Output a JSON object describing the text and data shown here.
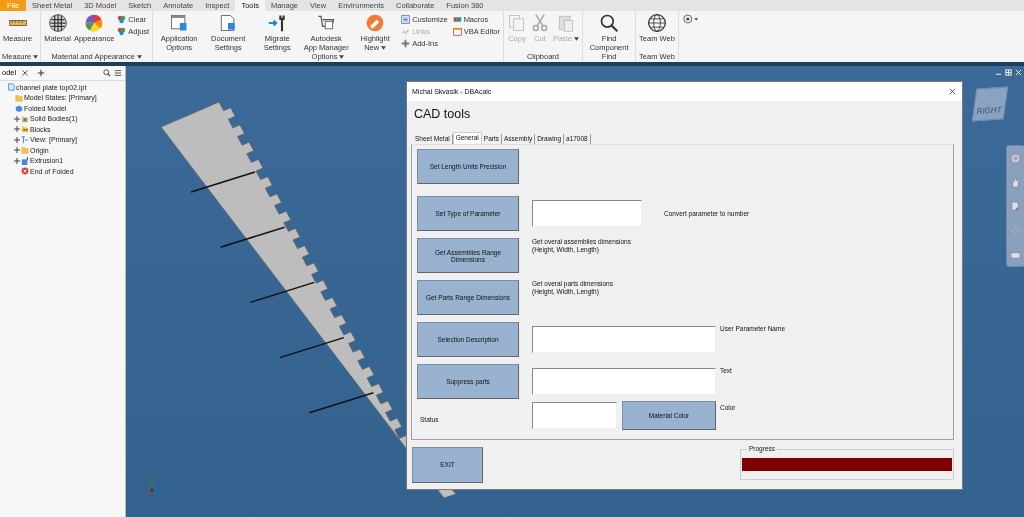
{
  "ribbon_tabs": [
    {
      "label": "File",
      "kind": "file",
      "selected": false
    },
    {
      "label": "Sheet Metal",
      "kind": "tab",
      "selected": false
    },
    {
      "label": "3D Model",
      "kind": "tab",
      "selected": false
    },
    {
      "label": "Sketch",
      "kind": "tab",
      "selected": false
    },
    {
      "label": "Annotate",
      "kind": "tab",
      "selected": false
    },
    {
      "label": "Inspect",
      "kind": "tab",
      "selected": false
    },
    {
      "label": "Tools",
      "kind": "tab",
      "selected": true
    },
    {
      "label": "Manage",
      "kind": "tab",
      "selected": false
    },
    {
      "label": "View",
      "kind": "tab",
      "selected": false
    },
    {
      "label": "Environments",
      "kind": "tab",
      "selected": false
    },
    {
      "label": "Collaborate",
      "kind": "tab",
      "selected": false
    },
    {
      "label": "Fusion 360",
      "kind": "tab",
      "selected": false
    }
  ],
  "ribbon_panels": [
    {
      "title": "Measure",
      "has_menu": true,
      "items": [
        {
          "label": "Measure",
          "kind": "large",
          "disabled": false,
          "dropdown": false
        }
      ]
    },
    {
      "title": "Material and Appearance",
      "has_menu": true,
      "items": [
        {
          "label": "Material",
          "kind": "large",
          "disabled": false,
          "dropdown": false
        },
        {
          "label": "Appearance",
          "kind": "large",
          "disabled": false,
          "dropdown": false
        },
        {
          "label": "Clear",
          "kind": "small",
          "disabled": false
        },
        {
          "label": "Adjust",
          "kind": "small",
          "disabled": false
        }
      ]
    },
    {
      "title": "Options",
      "has_menu": true,
      "items": [
        {
          "label": "Application Options",
          "kind": "large",
          "disabled": false,
          "dropdown": false
        },
        {
          "label": "Document Settings",
          "kind": "large",
          "disabled": false,
          "dropdown": false
        },
        {
          "label": "Migrate Settings",
          "kind": "large",
          "disabled": false,
          "dropdown": false
        },
        {
          "label": "Autodesk App Manager",
          "kind": "large",
          "disabled": false,
          "dropdown": false
        },
        {
          "label": "Highlight New",
          "kind": "large",
          "disabled": false,
          "dropdown": true
        },
        {
          "label": "Customize",
          "kind": "small",
          "disabled": false
        },
        {
          "label": "Links",
          "kind": "small",
          "disabled": true
        },
        {
          "label": "Add-Ins",
          "kind": "small",
          "disabled": false
        },
        {
          "label": "Macros",
          "kind": "small",
          "disabled": false
        },
        {
          "label": "VBA Editor",
          "kind": "small",
          "disabled": false
        }
      ]
    },
    {
      "title": "Clipboard",
      "has_menu": false,
      "items": [
        {
          "label": "Copy",
          "kind": "large",
          "disabled": true,
          "dropdown": false
        },
        {
          "label": "Cut",
          "kind": "large",
          "disabled": true,
          "dropdown": false
        },
        {
          "label": "Paste",
          "kind": "large",
          "disabled": true,
          "dropdown": true
        }
      ]
    },
    {
      "title": "Find",
      "has_menu": false,
      "items": [
        {
          "label": "Find Component",
          "kind": "large",
          "disabled": false,
          "dropdown": false
        }
      ]
    },
    {
      "title": "Team Web",
      "has_menu": false,
      "items": [
        {
          "label": "Team Web",
          "kind": "large",
          "disabled": false,
          "dropdown": false
        }
      ]
    }
  ],
  "browser": {
    "tab": "odel",
    "tree": [
      {
        "label": "channel plate top02.ipt",
        "kind": "part",
        "children": [
          {
            "label": "Model States: [Primary]",
            "kind": "folder"
          },
          {
            "label": "Folded Model",
            "kind": "model",
            "children": [
              {
                "label": "Solid Bodies(1)",
                "kind": "body",
                "expanded": false
              },
              {
                "label": "Blocks",
                "kind": "blocks",
                "expanded": false
              },
              {
                "label": "View: [Primary]",
                "kind": "view",
                "expanded": false
              },
              {
                "label": "Origin",
                "kind": "folder",
                "expanded": false
              },
              {
                "label": "Extrusion1",
                "kind": "extrusion",
                "expanded": false
              },
              {
                "label": "End of Folded",
                "kind": "end"
              }
            ]
          }
        ]
      }
    ]
  },
  "view_cube": {
    "face": "RIGHT"
  },
  "dialog": {
    "title": "Michal Skvasik - DBAcalc",
    "heading": "CAD tools",
    "tabs": [
      {
        "label": "Sheet Metal",
        "selected": false
      },
      {
        "label": "General",
        "selected": true
      },
      {
        "label": "Parts",
        "selected": false
      },
      {
        "label": "Assembly",
        "selected": false
      },
      {
        "label": "Drawing",
        "selected": false
      },
      {
        "label": "a17008",
        "selected": false
      }
    ],
    "rows": [
      {
        "kind": "button",
        "button": "Set Length Units Precision"
      },
      {
        "kind": "field",
        "button": "Set Type of Parameter",
        "label": "Convert parameter to number"
      },
      {
        "kind": "note",
        "button": "Get Assemblies Range Dimensions",
        "note": [
          "Get overal assemblies dimensions",
          "(Height, Width, Length)"
        ]
      },
      {
        "kind": "note",
        "button": "Get Parts Range Dimensions",
        "note": [
          "Get overal parts dimensions",
          "(Height, Width, Length)"
        ]
      },
      {
        "kind": "wide-field",
        "button": "Selection Description",
        "label": "User Parameter Name"
      },
      {
        "kind": "wide-field",
        "button": "Suppress parts",
        "label": "Text"
      },
      {
        "kind": "color",
        "status": "Status",
        "button": "Material Color",
        "label": "Color"
      }
    ],
    "exit": "EXIT",
    "progress": {
      "label": "Progress",
      "level": 1
    }
  }
}
